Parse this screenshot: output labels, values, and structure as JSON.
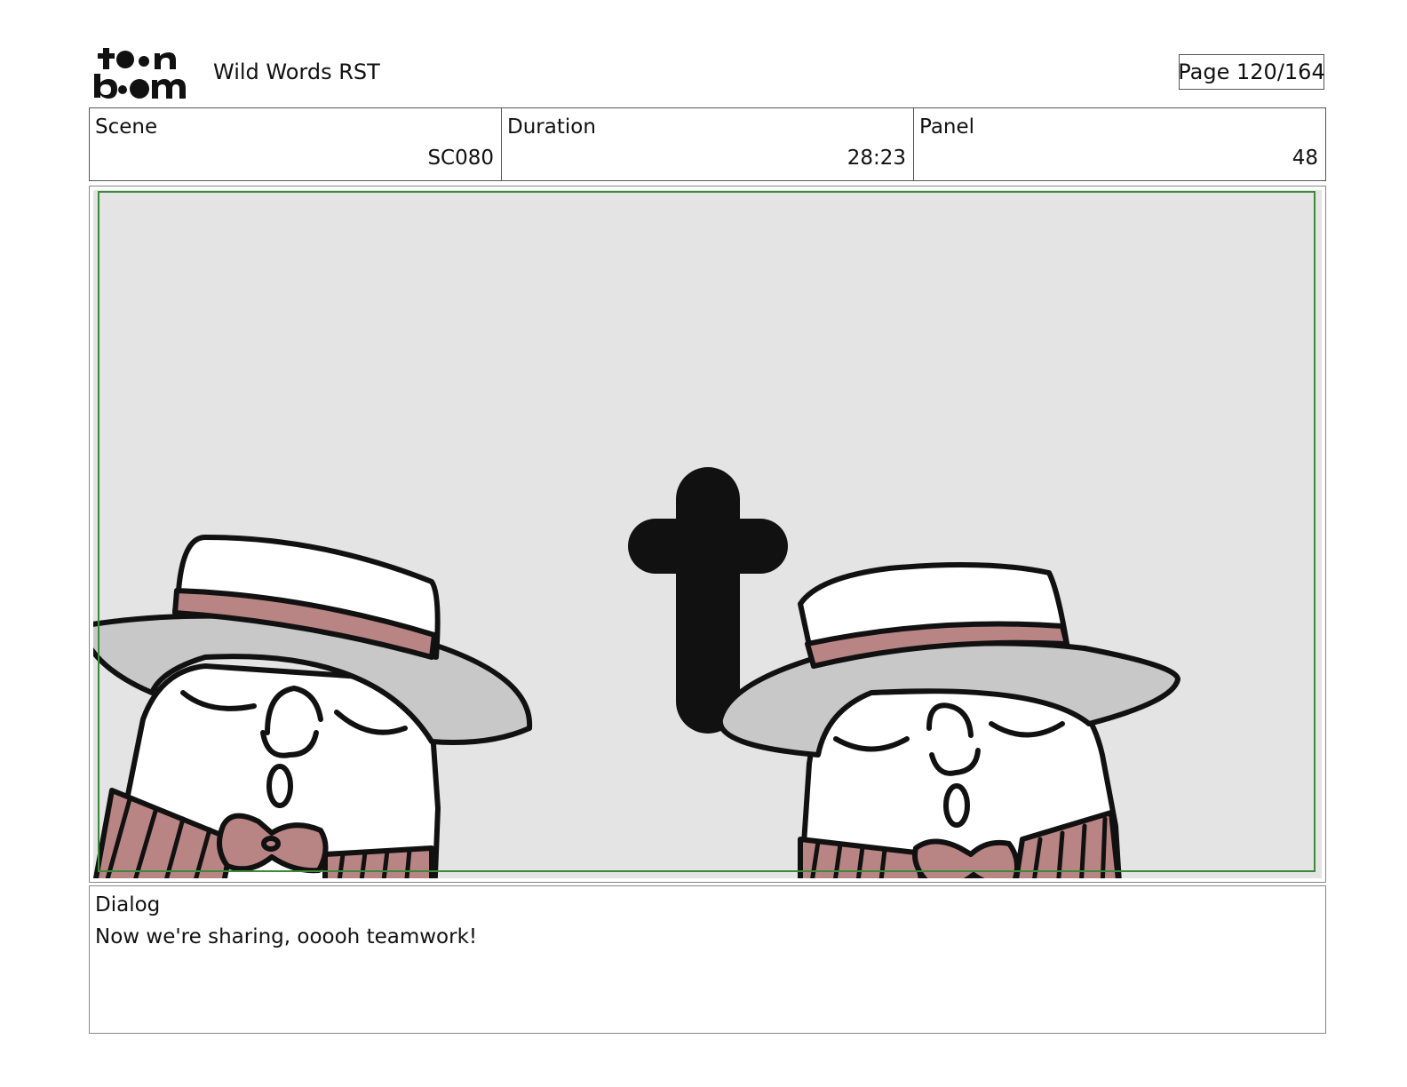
{
  "header": {
    "logo_text": "toon boom",
    "project_title": "Wild Words RST",
    "page_indicator": "Page 120/164"
  },
  "info": {
    "scene_label": "Scene",
    "scene_value": "SC080",
    "duration_label": "Duration",
    "duration_value": "28:23",
    "panel_label": "Panel",
    "panel_value": "48"
  },
  "panel": {
    "background_color": "#e4e4e4",
    "safe_frame_color": "#3a8a3a",
    "hat_band_color": "#b98484",
    "brim_color": "#c8c8c8"
  },
  "dialog": {
    "label": "Dialog",
    "text": "Now we're sharing, ooooh teamwork!"
  }
}
